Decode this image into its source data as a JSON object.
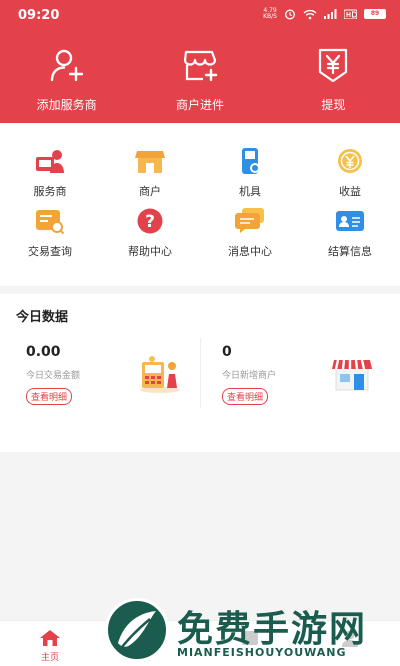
{
  "status": {
    "time": "09:20",
    "net_speed_value": "4.79",
    "net_speed_unit": "KB/S",
    "battery": "89"
  },
  "top_actions": [
    {
      "label": "添加服务商",
      "icon": "add-user-icon"
    },
    {
      "label": "商户进件",
      "icon": "store-add-icon"
    },
    {
      "label": "提现",
      "icon": "yuan-withdraw-icon"
    }
  ],
  "grid": [
    {
      "label": "服务商",
      "icon": "service-provider-icon"
    },
    {
      "label": "商户",
      "icon": "merchant-icon"
    },
    {
      "label": "机具",
      "icon": "pos-device-icon"
    },
    {
      "label": "收益",
      "icon": "earnings-icon"
    },
    {
      "label": "交易查询",
      "icon": "transaction-search-icon"
    },
    {
      "label": "帮助中心",
      "icon": "help-icon"
    },
    {
      "label": "消息中心",
      "icon": "message-icon"
    },
    {
      "label": "结算信息",
      "icon": "settlement-card-icon"
    }
  ],
  "today": {
    "title": "今日数据",
    "amount_value": "0.00",
    "amount_label": "今日交易金额",
    "amount_detail": "查看明细",
    "merchants_value": "0",
    "merchants_label": "今日新增商户",
    "merchants_detail": "查看明细"
  },
  "tabs": [
    {
      "label": "主页",
      "icon": "home-icon",
      "active": true
    },
    {
      "label": "",
      "icon": "tab-icon-2"
    },
    {
      "label": "",
      "icon": "tab-icon-3"
    },
    {
      "label": "",
      "icon": "profile-icon"
    }
  ],
  "watermark": {
    "title": "免费手游网",
    "subtitle": "MIANFEISHOUYOUWANG"
  },
  "colors": {
    "brand_red": "#e4424a",
    "watermark_green": "#1a5d4f"
  }
}
